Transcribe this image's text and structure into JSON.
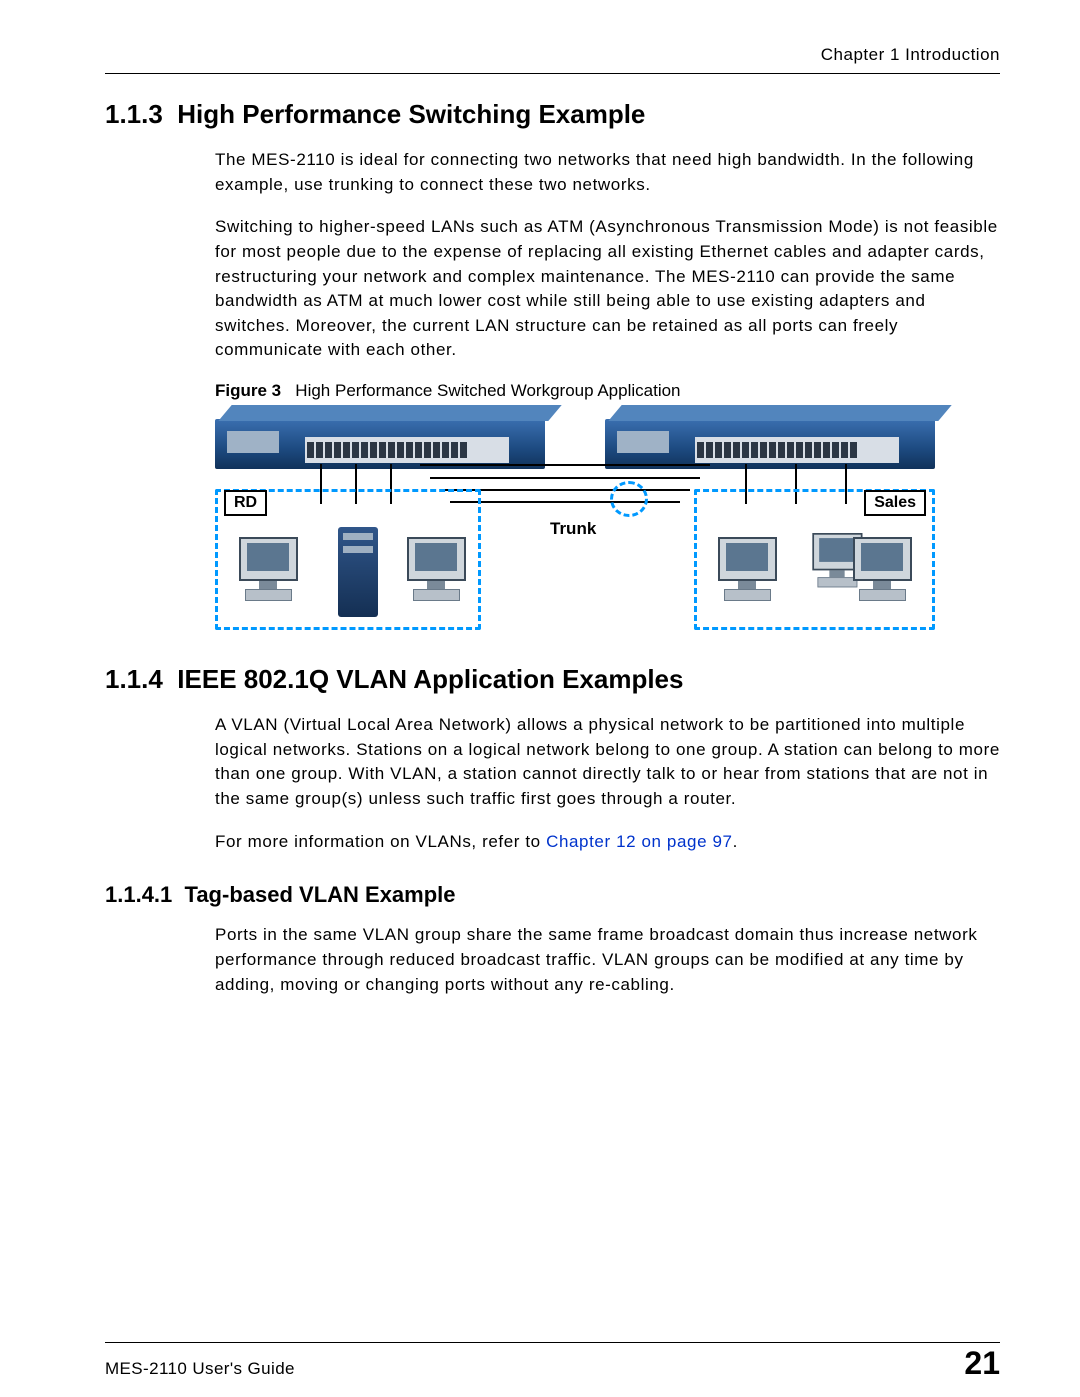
{
  "header": {
    "chapter": "Chapter 1 Introduction"
  },
  "s113": {
    "number": "1.1.3",
    "title": "High Performance Switching Example",
    "p1": "The MES-2110 is ideal for connecting two networks that need high bandwidth. In the following example, use trunking to connect these two networks.",
    "p2": "Switching to higher-speed LANs such as ATM (Asynchronous Transmission Mode) is not feasible for most people due to the expense of replacing all existing Ethernet cables and adapter cards, restructuring your network and complex maintenance. The MES-2110 can provide the same bandwidth as ATM at much lower cost while still being able to use existing adapters and switches. Moreover, the current LAN structure can be retained as all ports can freely communicate with each other."
  },
  "figure3": {
    "label": "Figure 3",
    "caption": "High Performance Switched Workgroup Application",
    "rd_label": "RD",
    "sales_label": "Sales",
    "trunk_label": "Trunk"
  },
  "s114": {
    "number": "1.1.4",
    "title": "IEEE 802.1Q VLAN Application Examples",
    "p1": "A VLAN (Virtual Local Area Network) allows a physical network to be partitioned into multiple logical networks. Stations on a logical network belong to one group. A station can belong to more than one group. With VLAN, a station cannot directly talk to or hear from stations that are not in the same group(s) unless such traffic first goes through a router.",
    "p2_prefix": "For more information on VLANs, refer to ",
    "p2_link": "Chapter 12 on page 97",
    "p2_suffix": "."
  },
  "s1141": {
    "number": "1.1.4.1",
    "title": "Tag-based VLAN Example",
    "p1": "Ports in the same VLAN group share the same frame broadcast domain thus increase network performance through reduced broadcast traffic. VLAN groups can be modified at any time by adding, moving or changing ports without any re-cabling."
  },
  "footer": {
    "guide": "MES-2110 User's Guide",
    "page": "21"
  }
}
